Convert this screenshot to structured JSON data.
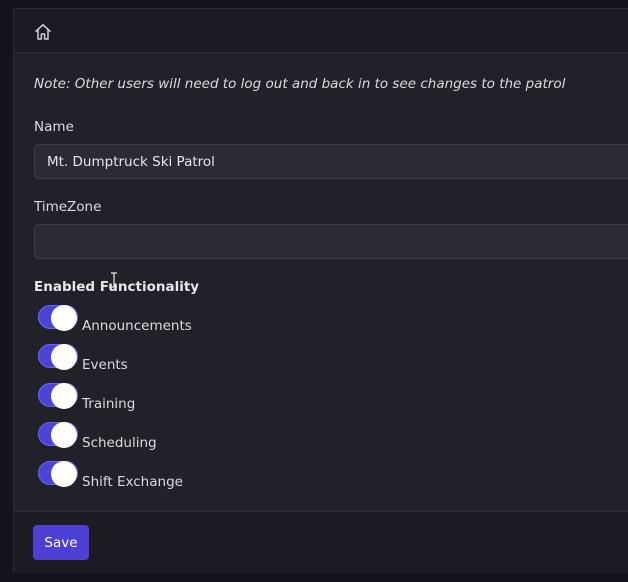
{
  "header": {
    "icon": "home-icon"
  },
  "form": {
    "note": "Note: Other users will need to log out and back in to see changes to the patrol",
    "name_label": "Name",
    "name_value": "Mt. Dumptruck Ski Patrol",
    "timezone_label": "TimeZone",
    "timezone_value": "",
    "section_title": "Enabled Functionality",
    "features": [
      {
        "label": "Announcements",
        "enabled": true
      },
      {
        "label": "Events",
        "enabled": true
      },
      {
        "label": "Training",
        "enabled": true
      },
      {
        "label": "Scheduling",
        "enabled": true
      },
      {
        "label": "Shift Exchange",
        "enabled": true
      }
    ]
  },
  "footer": {
    "save_label": "Save"
  },
  "colors": {
    "accent": "#4d3fd2",
    "toggle_on": "#4b44d6",
    "background": "#13131c",
    "card": "#212129"
  }
}
